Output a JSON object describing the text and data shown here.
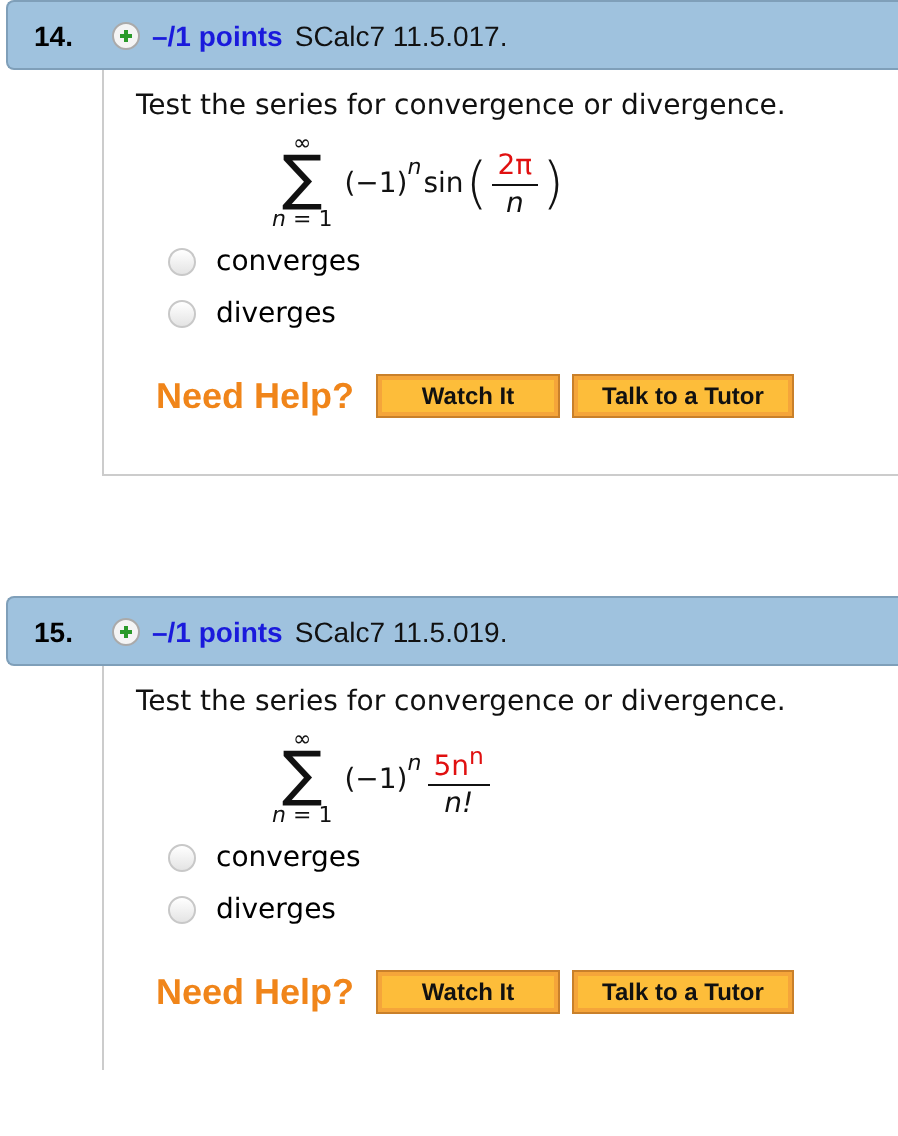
{
  "questions": [
    {
      "number": "14.",
      "points": "–/1 points",
      "source": "SCalc7 11.5.017.",
      "prompt": "Test the series for convergence or divergence.",
      "formula": {
        "top": "∞",
        "sign": "∑",
        "bottom": "n = 1",
        "factor": "(−1)",
        "power": "n",
        "func": "sin",
        "open": "(",
        "close": ")",
        "numerator": "2π",
        "denominator": "n"
      },
      "options": [
        {
          "label": "converges",
          "selected": false
        },
        {
          "label": "diverges",
          "selected": false
        }
      ],
      "help": {
        "label": "Need Help?",
        "buttons": [
          "Watch It",
          "Talk to a Tutor"
        ]
      }
    },
    {
      "number": "15.",
      "points": "–/1 points",
      "source": "SCalc7 11.5.019.",
      "prompt": "Test the series for convergence or divergence.",
      "formula": {
        "top": "∞",
        "sign": "∑",
        "bottom": "n = 1",
        "factor": "(−1)",
        "power": "n",
        "numerator": "5n$^{n}$",
        "denominator": "n!"
      },
      "options": [
        {
          "label": "converges",
          "selected": false
        },
        {
          "label": "diverges",
          "selected": false
        }
      ],
      "help": {
        "label": "Need Help?",
        "buttons": [
          "Watch It",
          "Talk to a Tutor"
        ]
      }
    }
  ]
}
